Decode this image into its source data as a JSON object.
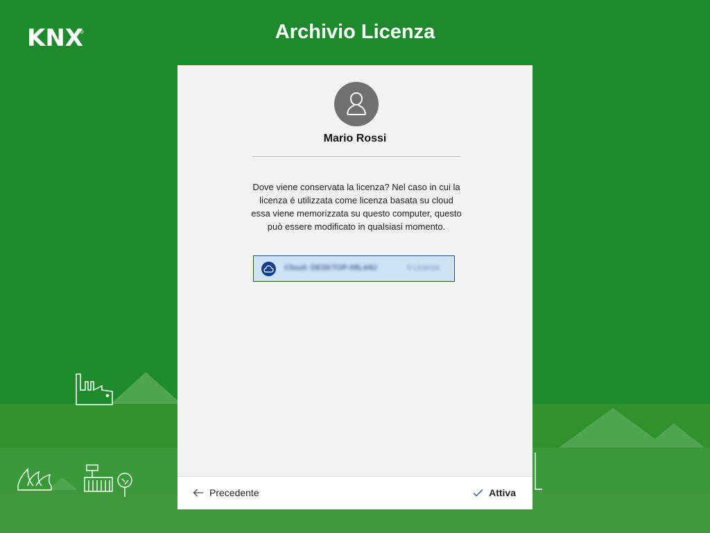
{
  "header": {
    "logo_text": "KNX",
    "title": "Archivio Licenza"
  },
  "user": {
    "name": "Mario Rossi",
    "avatar_icon": "user-icon"
  },
  "description": "Dove viene conservata la licenza? Nel caso in cui la licenza é utilizzata come licenza basata su cloud essa viene memorizzata su questo computer, questo può essere modificato in qualsiasi momento.",
  "storage_option": {
    "icon": "cloud-icon",
    "label": "Cloud: DESKTOP-09L44U",
    "count": "0 Licenze"
  },
  "footer": {
    "back_label": "Precedente",
    "back_icon": "arrow-left-icon",
    "activate_label": "Attiva",
    "activate_icon": "checkmark-icon"
  },
  "colors": {
    "background": "#1e8a2d",
    "panel": "#f2f2f2",
    "selection": "#cfe3f7",
    "selection_border": "#20508f",
    "accent_dark_blue": "#0f3f8a"
  }
}
